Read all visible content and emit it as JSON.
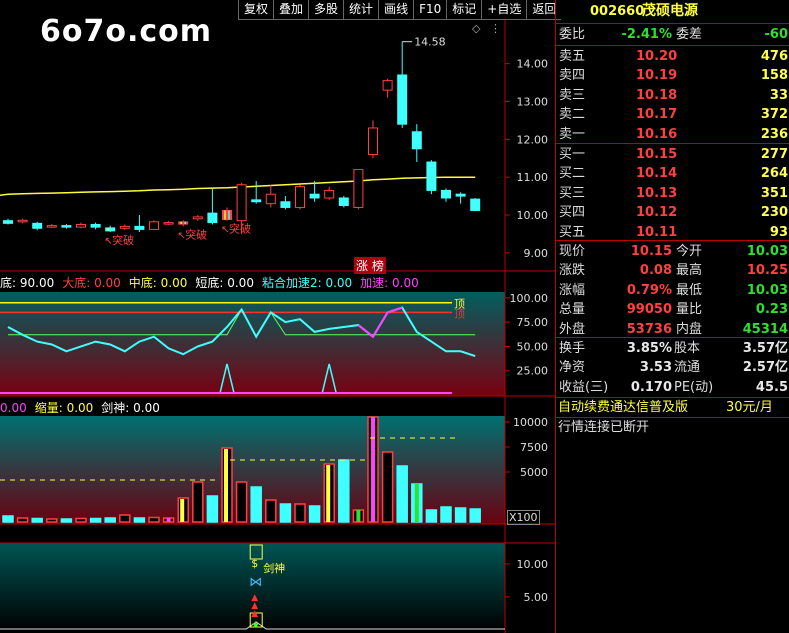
{
  "watermark": "6o7o.com",
  "toolbar": [
    "复权",
    "叠加",
    "多股",
    "统计",
    "画线",
    "F10",
    "标记",
    "+自选",
    "返回"
  ],
  "colors": {
    "up": "#ff4040",
    "down": "#40ffff",
    "ma": "#ffff40",
    "bg": "#000000"
  },
  "main_chart": {
    "peak_label": "14.58",
    "breakout_labels": [
      "突破",
      "突破",
      "突破"
    ],
    "badge": "涨 榜",
    "corner_icon": "diamond-icon"
  },
  "chart_data": [
    {
      "type": "candlestick",
      "name": "price",
      "y_ticks": [
        "14.00",
        "13.00",
        "12.00",
        "11.00",
        "10.00",
        "9.00"
      ],
      "ylim": [
        8.6,
        15.1
      ],
      "candles": [
        {
          "o": 9.85,
          "c": 9.78,
          "h": 9.9,
          "l": 9.75
        },
        {
          "o": 9.82,
          "c": 9.86,
          "h": 9.9,
          "l": 9.78
        },
        {
          "o": 9.78,
          "c": 9.65,
          "h": 9.82,
          "l": 9.6
        },
        {
          "o": 9.7,
          "c": 9.72,
          "h": 9.76,
          "l": 9.66
        },
        {
          "o": 9.72,
          "c": 9.68,
          "h": 9.76,
          "l": 9.64
        },
        {
          "o": 9.68,
          "c": 9.75,
          "h": 9.8,
          "l": 9.65
        },
        {
          "o": 9.75,
          "c": 9.68,
          "h": 9.8,
          "l": 9.62
        },
        {
          "o": 9.66,
          "c": 9.58,
          "h": 9.72,
          "l": 9.55
        },
        {
          "o": 9.65,
          "c": 9.7,
          "h": 9.75,
          "l": 9.6
        },
        {
          "o": 9.7,
          "c": 9.62,
          "h": 10.0,
          "l": 9.55
        },
        {
          "o": 9.62,
          "c": 9.82,
          "h": 9.86,
          "l": 9.6
        },
        {
          "o": 9.78,
          "c": 9.8,
          "h": 9.84,
          "l": 9.74
        },
        {
          "o": 9.76,
          "c": 9.82,
          "h": 9.86,
          "l": 9.7
        },
        {
          "o": 9.9,
          "c": 9.95,
          "h": 10.0,
          "l": 9.85
        },
        {
          "o": 10.05,
          "c": 9.8,
          "h": 10.7,
          "l": 9.75
        },
        {
          "o": 9.88,
          "c": 10.12,
          "h": 10.2,
          "l": 9.85
        },
        {
          "o": 9.85,
          "c": 10.8,
          "h": 10.85,
          "l": 9.5
        },
        {
          "o": 10.4,
          "c": 10.35,
          "h": 10.9,
          "l": 10.3
        },
        {
          "o": 10.3,
          "c": 10.55,
          "h": 10.8,
          "l": 10.2
        },
        {
          "o": 10.35,
          "c": 10.2,
          "h": 10.5,
          "l": 10.15
        },
        {
          "o": 10.2,
          "c": 10.75,
          "h": 10.8,
          "l": 10.15
        },
        {
          "o": 10.55,
          "c": 10.45,
          "h": 10.9,
          "l": 10.35
        },
        {
          "o": 10.45,
          "c": 10.65,
          "h": 10.75,
          "l": 10.4
        },
        {
          "o": 10.45,
          "c": 10.25,
          "h": 10.5,
          "l": 10.2
        },
        {
          "o": 10.2,
          "c": 11.2,
          "h": 11.2,
          "l": 10.15
        },
        {
          "o": 11.6,
          "c": 12.3,
          "h": 12.5,
          "l": 11.5
        },
        {
          "o": 13.3,
          "c": 13.55,
          "h": 13.6,
          "l": 13.1
        },
        {
          "o": 13.7,
          "c": 12.4,
          "h": 14.58,
          "l": 12.3
        },
        {
          "o": 12.2,
          "c": 11.75,
          "h": 12.4,
          "l": 11.4
        },
        {
          "o": 11.4,
          "c": 10.65,
          "h": 11.45,
          "l": 10.55
        },
        {
          "o": 10.65,
          "c": 10.45,
          "h": 10.7,
          "l": 10.35
        },
        {
          "o": 10.55,
          "c": 10.5,
          "h": 10.6,
          "l": 10.3
        },
        {
          "o": 10.42,
          "c": 10.12,
          "h": 10.45,
          "l": 10.1
        }
      ],
      "ma": [
        10.55,
        10.56,
        10.57,
        10.58,
        10.59,
        10.6,
        10.61,
        10.62,
        10.63,
        10.64,
        10.66,
        10.67,
        10.68,
        10.7,
        10.71,
        10.72,
        10.74,
        10.76,
        10.78,
        10.8,
        10.82,
        10.84,
        10.86,
        10.88,
        10.9,
        10.93,
        10.95,
        10.97,
        10.98,
        10.99,
        11.0,
        11.0,
        11.0
      ],
      "breakout_index": [
        7,
        12,
        15
      ]
    },
    {
      "type": "line",
      "name": "indicator",
      "legend": [
        {
          "label": "底: 90.00",
          "color": "#ffffff"
        },
        {
          "label": "大底: 0.00",
          "color": "#ff4040"
        },
        {
          "label": "中底: 0.00",
          "color": "#ffff40"
        },
        {
          "label": "短底: 0.00",
          "color": "#ffffff"
        },
        {
          "label": "粘合加速2: 0.00",
          "color": "#40ffff"
        },
        {
          "label": "加速: 0.00",
          "color": "#ff40ff"
        }
      ],
      "y_ticks": [
        "100.00",
        "75.00",
        "50.00",
        "25.00"
      ],
      "ylim": [
        0,
        105
      ],
      "ref_levels": [
        {
          "label": "顶",
          "value": 95,
          "color": "#ffff00"
        },
        {
          "label": "顶",
          "value": 85,
          "color": "#ff3030"
        }
      ],
      "cyan": [
        70,
        62,
        55,
        52,
        45,
        50,
        55,
        52,
        45,
        55,
        60,
        48,
        42,
        50,
        55,
        70,
        88,
        60,
        85,
        75,
        78,
        65,
        68,
        70,
        72,
        60,
        85,
        90,
        65,
        55,
        45,
        45,
        40
      ],
      "green": [
        62,
        62,
        62,
        62,
        62,
        62,
        62,
        62,
        62,
        62,
        62,
        62,
        62,
        62,
        62,
        62,
        88,
        60,
        85,
        62,
        62,
        62,
        62,
        62,
        62,
        62,
        62,
        62,
        62,
        62,
        62,
        62,
        62
      ]
    },
    {
      "type": "bar",
      "name": "volume",
      "legend": [
        {
          "label": "0.00",
          "color": "#ff40ff"
        },
        {
          "label": "缩量: 0.00",
          "color": "#ffff40"
        },
        {
          "label": "剑神: 0.00",
          "color": "#ffffff"
        }
      ],
      "y_ticks": [
        "10000",
        "7500",
        "5000"
      ],
      "unit_label": "X100",
      "ylim": [
        0,
        10500
      ],
      "values": [
        600,
        400,
        350,
        300,
        300,
        350,
        350,
        400,
        700,
        400,
        450,
        400,
        2400,
        4000,
        2600,
        7400,
        4000,
        3500,
        2200,
        1800,
        1800,
        1600,
        5800,
        6200,
        1200,
        12000,
        7000,
        5600,
        3800,
        1200,
        1500,
        1400,
        1300
      ]
    },
    {
      "type": "line",
      "name": "jianshen",
      "label": "剑神",
      "y_ticks": [
        "10.00",
        "5.00"
      ],
      "ylim": [
        0,
        13
      ]
    }
  ],
  "right_panel": {
    "code": "002660",
    "name": "茂硕电源",
    "wb_label": "委比",
    "wb_value": "-2.41%",
    "wc_label": "委差",
    "wc_value": "-60",
    "asks": [
      {
        "label": "卖五",
        "price": "10.20",
        "vol": "476"
      },
      {
        "label": "卖四",
        "price": "10.19",
        "vol": "158"
      },
      {
        "label": "卖三",
        "price": "10.18",
        "vol": "33"
      },
      {
        "label": "卖二",
        "price": "10.17",
        "vol": "372"
      },
      {
        "label": "卖一",
        "price": "10.16",
        "vol": "236"
      }
    ],
    "bids": [
      {
        "label": "买一",
        "price": "10.15",
        "vol": "277"
      },
      {
        "label": "买二",
        "price": "10.14",
        "vol": "264"
      },
      {
        "label": "买三",
        "price": "10.13",
        "vol": "351"
      },
      {
        "label": "买四",
        "price": "10.12",
        "vol": "230"
      },
      {
        "label": "买五",
        "price": "10.11",
        "vol": "93"
      }
    ],
    "stats": [
      {
        "l1": "现价",
        "v1": "10.15",
        "c1": "red",
        "l2": "今开",
        "v2": "10.03",
        "c2": "grn"
      },
      {
        "l1": "涨跌",
        "v1": "0.08",
        "c1": "red",
        "l2": "最高",
        "v2": "10.25",
        "c2": "red"
      },
      {
        "l1": "涨幅",
        "v1": "0.79%",
        "c1": "red",
        "l2": "最低",
        "v2": "10.03",
        "c2": "grn"
      },
      {
        "l1": "总量",
        "v1": "99050",
        "c1": "red",
        "l2": "量比",
        "v2": "0.23",
        "c2": "grn"
      },
      {
        "l1": "外盘",
        "v1": "53736",
        "c1": "red",
        "l2": "内盘",
        "v2": "45314",
        "c2": "grn"
      }
    ],
    "fin": [
      {
        "l1": "换手",
        "v1": "3.85%",
        "l2": "股本",
        "v2": "3.57亿"
      },
      {
        "l1": "净资",
        "v1": "3.53",
        "l2": "流通",
        "v2": "2.57亿"
      },
      {
        "l1": "收益(三)",
        "v1": "0.170",
        "l2": "PE(动)",
        "v2": "45.5"
      }
    ],
    "promo": "自动续费通达信普及版",
    "promo_price": "30元/月",
    "status": "行情连接已断开"
  }
}
